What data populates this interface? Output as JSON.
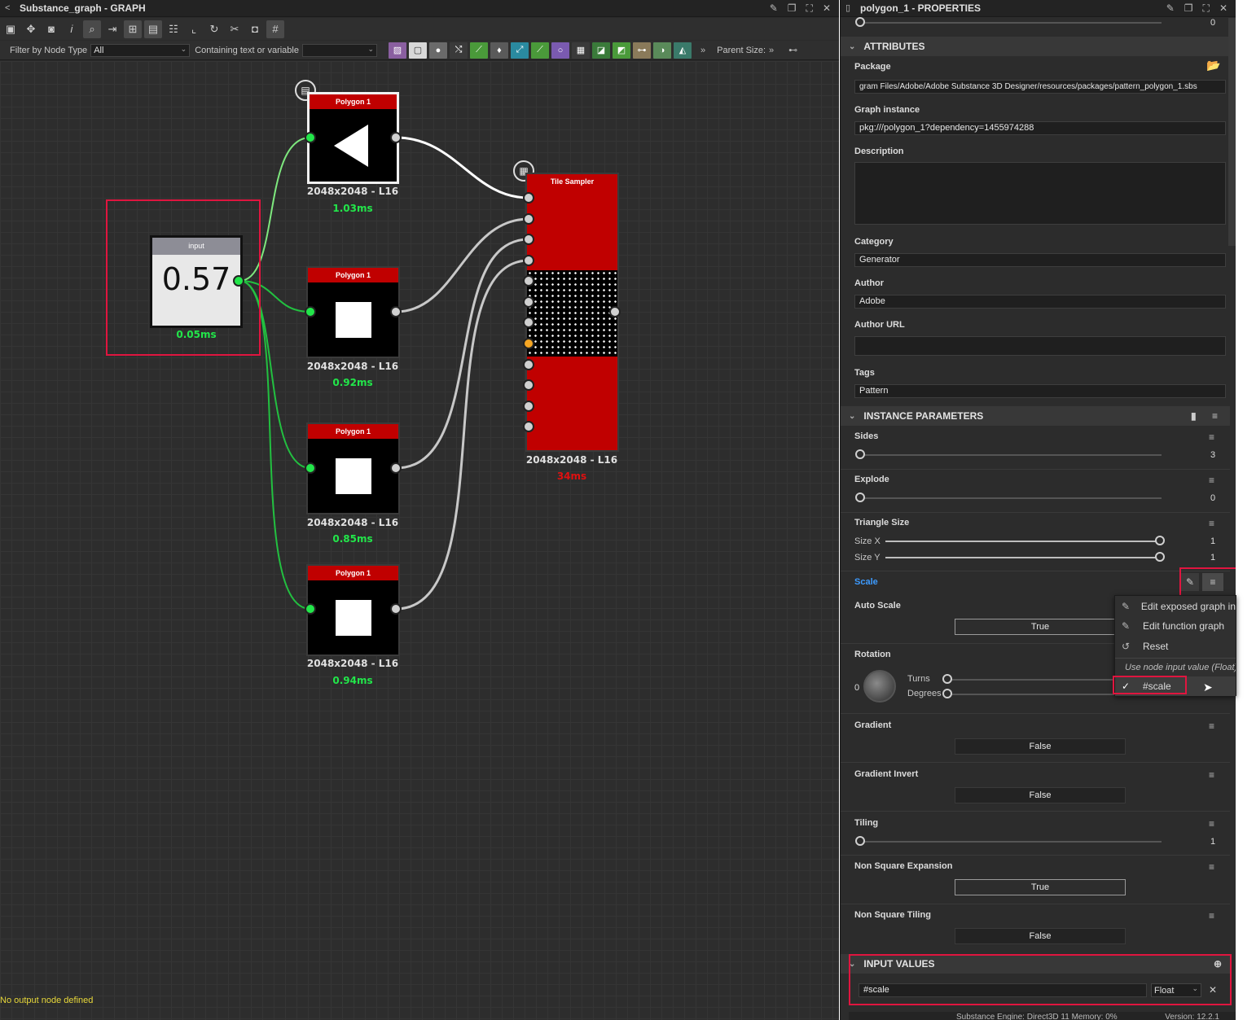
{
  "graph": {
    "title": "Substance_graph - GRAPH",
    "filter_label": "Filter by Node Type",
    "filter_value": "All",
    "containing_label": "Containing text or variable",
    "containing_value": "",
    "parent_size_label": "Parent Size:",
    "status_text": "No output node defined",
    "nodes": {
      "input": {
        "title": "input",
        "value": "0.57",
        "time": "0.05ms",
        "time_color": "#22e64a"
      },
      "poly1": {
        "title": "Polygon 1",
        "info": "2048x2048 - L16",
        "time": "1.03ms",
        "time_color": "#22e64a"
      },
      "poly2": {
        "title": "Polygon 1",
        "info": "2048x2048 - L16",
        "time": "0.92ms",
        "time_color": "#22e64a"
      },
      "poly3": {
        "title": "Polygon 1",
        "info": "2048x2048 - L16",
        "time": "0.85ms",
        "time_color": "#22e64a"
      },
      "poly4": {
        "title": "Polygon 1",
        "info": "2048x2048 - L16",
        "time": "0.94ms",
        "time_color": "#22e64a"
      },
      "tile": {
        "title": "Tile Sampler",
        "info": "2048x2048 - L16",
        "time": "34ms",
        "time_color": "#e01010"
      }
    }
  },
  "props": {
    "title": "polygon_1 - PROPERTIES",
    "top_slider_value": "0",
    "attributes_header": "ATTRIBUTES",
    "package_label": "Package",
    "package_value": "gram Files/Adobe/Adobe Substance 3D Designer/resources/packages/pattern_polygon_1.sbs",
    "graph_instance_label": "Graph instance",
    "graph_instance_value": "pkg:///polygon_1?dependency=1455974288",
    "description_label": "Description",
    "category_label": "Category",
    "category_value": "Generator",
    "author_label": "Author",
    "author_value": "Adobe",
    "author_url_label": "Author URL",
    "author_url_value": "",
    "tags_label": "Tags",
    "tags_value": "Pattern",
    "instance_header": "INSTANCE PARAMETERS",
    "sides_label": "Sides",
    "sides_value": "3",
    "explode_label": "Explode",
    "explode_value": "0",
    "triangle_size_label": "Triangle Size",
    "size_x_label": "Size X",
    "size_x_value": "1",
    "size_y_label": "Size Y",
    "size_y_value": "1",
    "scale_label": "Scale",
    "auto_scale_label": "Auto Scale",
    "auto_scale_value": "True",
    "rotation_label": "Rotation",
    "rotation_dial_value": "0",
    "turns_label": "Turns",
    "degrees_label": "Degrees",
    "gradient_label": "Gradient",
    "gradient_value": "False",
    "gradient_invert_label": "Gradient Invert",
    "gradient_invert_value": "False",
    "tiling_label": "Tiling",
    "tiling_value": "1",
    "nse_label": "Non Square Expansion",
    "nse_value": "True",
    "nst_label": "Non Square Tiling",
    "nst_value": "False",
    "input_values_header": "INPUT VALUES",
    "input_value_name": "#scale",
    "input_value_type": "Float",
    "footer_engine": "Substance Engine: Direct3D 11  Memory: 0%",
    "footer_version": "Version: 12.2.1"
  },
  "context_menu": {
    "edit_exposed": "Edit exposed graph in",
    "edit_function": "Edit function graph",
    "reset": "Reset",
    "use_node_input": "Use node input value (Float)",
    "scale_option": "#scale"
  }
}
